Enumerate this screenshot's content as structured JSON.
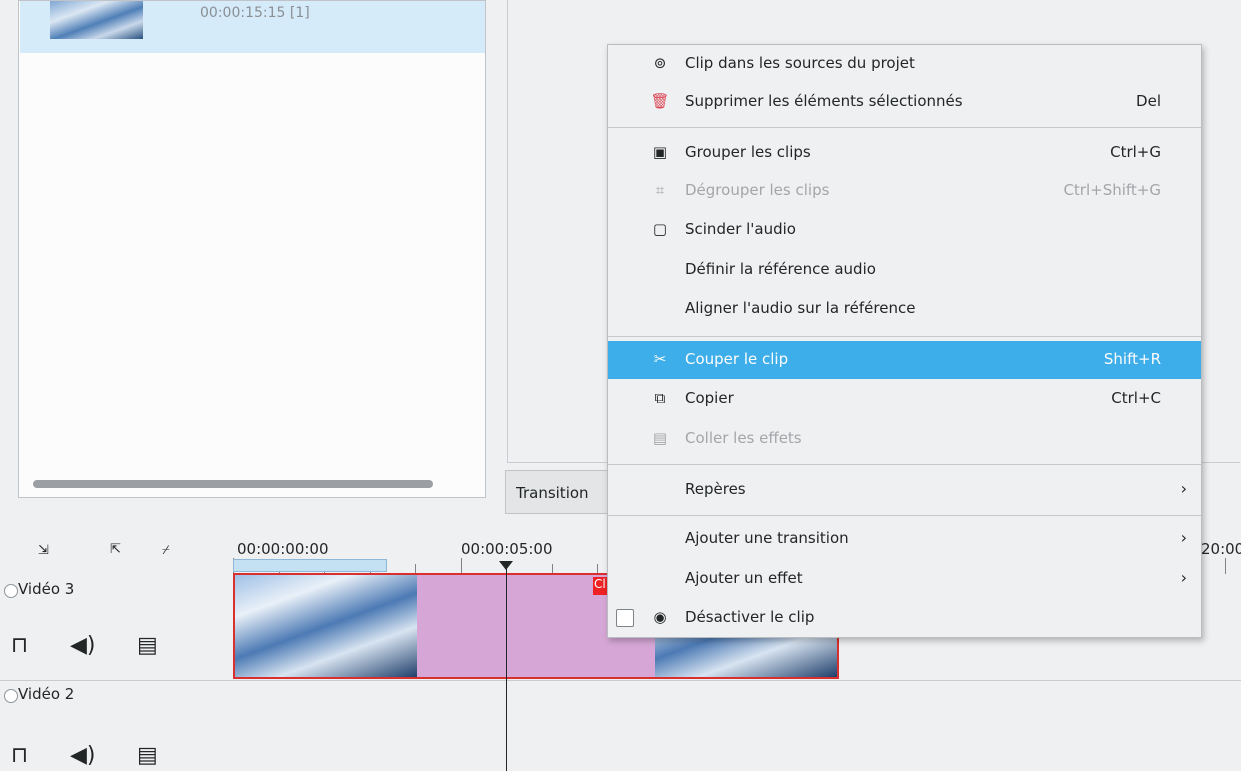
{
  "bin": {
    "timecode": "00:00:15:15 [1]"
  },
  "monitor": {
    "tab_label": "Transition"
  },
  "timeline": {
    "ruler_labels": [
      "00:00:00:00",
      "00:00:05:00",
      "20:00"
    ],
    "tracks": [
      {
        "name": "Vidéo 3"
      },
      {
        "name": "Vidéo 2"
      }
    ],
    "clip_badge": "Cl"
  },
  "menu": {
    "items": [
      {
        "label": "Clip dans les sources du projet",
        "shortcut": "",
        "icon": "clip-source-icon"
      },
      {
        "label": "Supprimer les éléments sélectionnés",
        "shortcut": "Del",
        "icon": "trash-icon"
      },
      {
        "label": "Grouper les clips",
        "shortcut": "Ctrl+G",
        "icon": "group-icon"
      },
      {
        "label": "Dégrouper les clips",
        "shortcut": "Ctrl+Shift+G",
        "icon": "ungroup-icon",
        "disabled": true
      },
      {
        "label": "Scinder l'audio",
        "shortcut": "",
        "icon": "split-audio-icon"
      },
      {
        "label": "Définir la référence audio",
        "shortcut": ""
      },
      {
        "label": "Aligner l'audio sur la référence",
        "shortcut": ""
      },
      {
        "label": "Couper le clip",
        "shortcut": "Shift+R",
        "icon": "scissors-icon",
        "highlighted": true
      },
      {
        "label": "Copier",
        "shortcut": "Ctrl+C",
        "icon": "copy-icon"
      },
      {
        "label": "Coller les effets",
        "shortcut": "",
        "icon": "paste-icon",
        "disabled": true
      },
      {
        "label": "Repères",
        "shortcut": "",
        "submenu": true
      },
      {
        "label": "Ajouter une transition",
        "shortcut": "",
        "submenu": true
      },
      {
        "label": "Ajouter un effet",
        "shortcut": "",
        "submenu": true
      },
      {
        "label": "Désactiver le clip",
        "shortcut": "",
        "icon": "eye-icon",
        "checkbox": true,
        "checked": false
      }
    ]
  },
  "colors": {
    "highlight": "#3daee9",
    "clip_border": "#da2f2f",
    "clip_fill": "#d6a7d6"
  }
}
